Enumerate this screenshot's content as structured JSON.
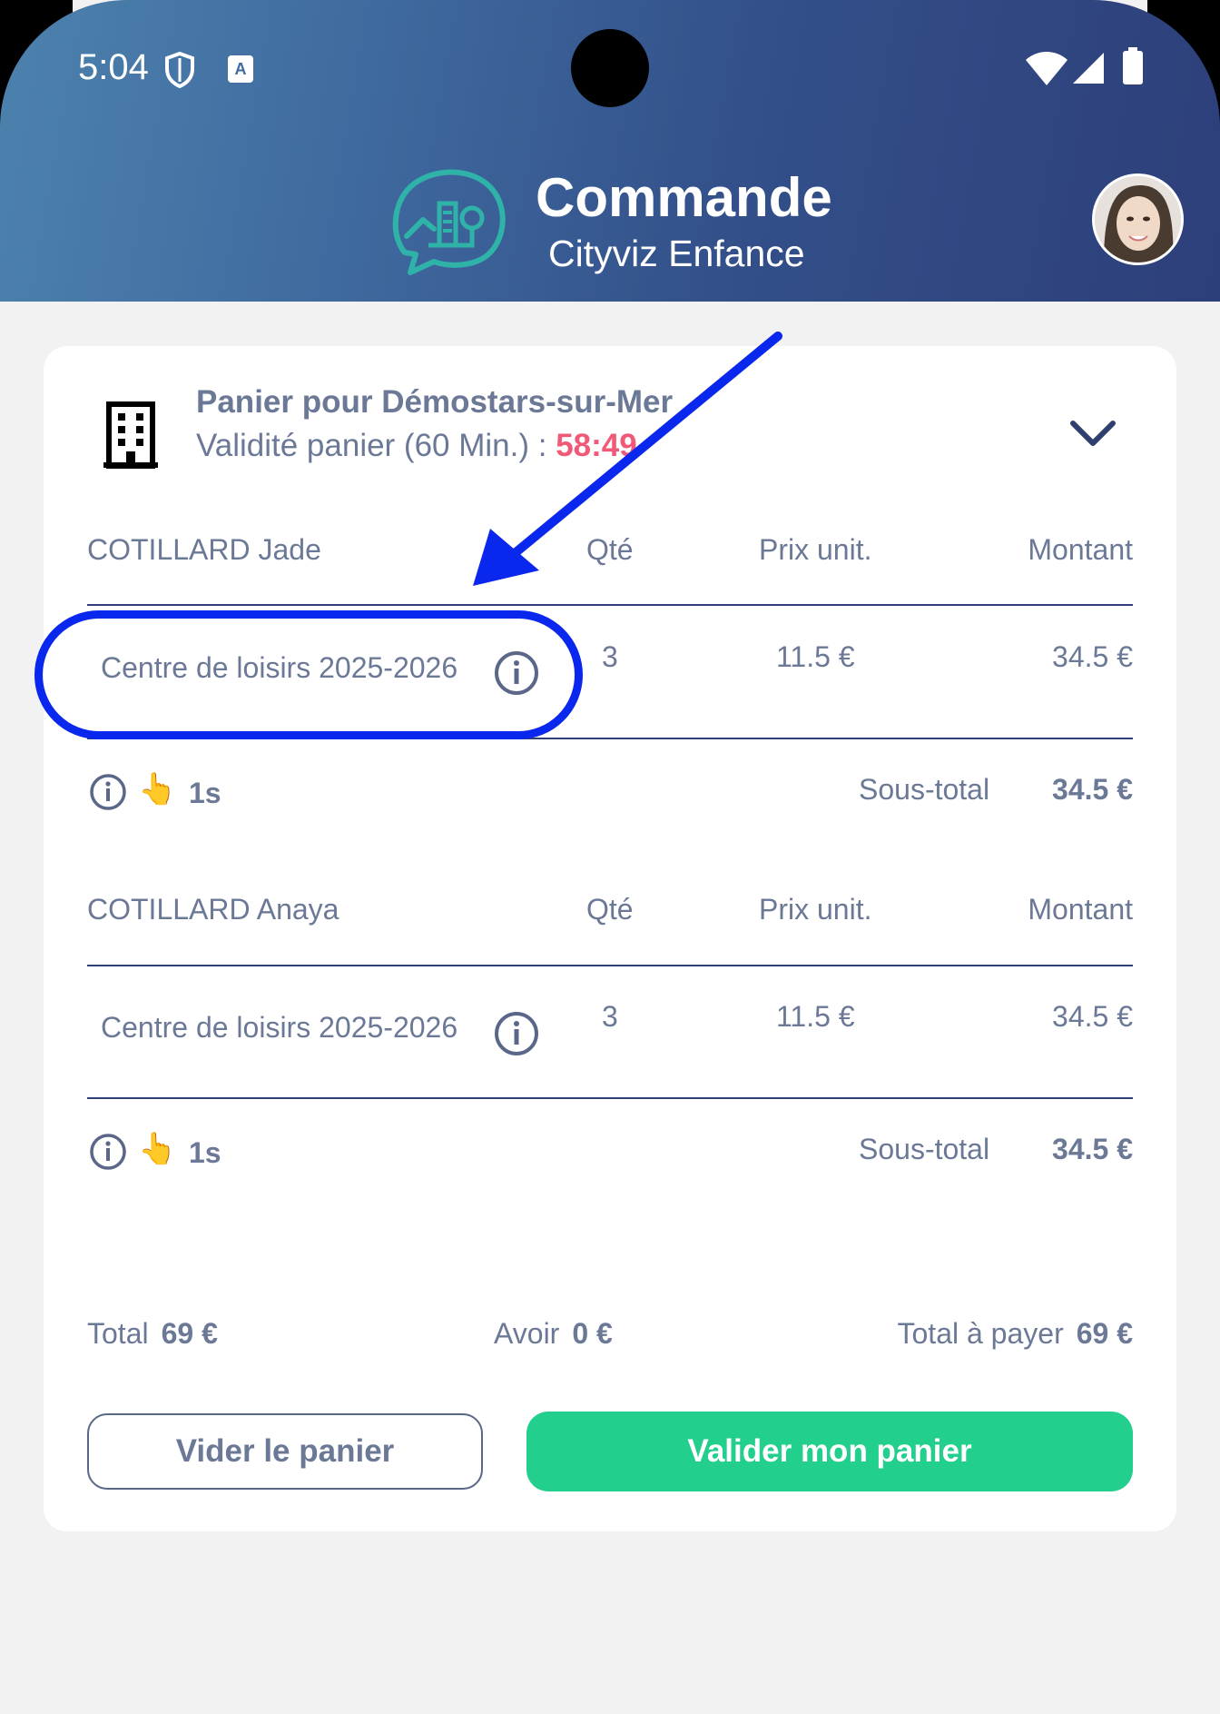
{
  "status_bar": {
    "time": "5:04"
  },
  "header": {
    "title": "Commande",
    "subtitle": "Cityviz Enfance"
  },
  "cart": {
    "title": "Panier pour Démostars-sur-Mer",
    "validity_label": "Validité panier (60 Min.) :",
    "timer": "58:49"
  },
  "columns": {
    "qty": "Qté",
    "unit_price": "Prix unit.",
    "amount": "Montant"
  },
  "children": [
    {
      "name": "COTILLARD Jade",
      "item": "Centre de loisirs 2025-2026",
      "qty": "3",
      "unit_price": "11.5 €",
      "amount": "34.5 €",
      "duration": "1s",
      "subtotal_label": "Sous-total",
      "subtotal": "34.5 €"
    },
    {
      "name": "COTILLARD Anaya",
      "item": "Centre de loisirs 2025-2026",
      "qty": "3",
      "unit_price": "11.5 €",
      "amount": "34.5 €",
      "duration": "1s",
      "subtotal_label": "Sous-total",
      "subtotal": "34.5 €"
    }
  ],
  "totals": {
    "total_label": "Total",
    "total": "69 €",
    "credit_label": "Avoir",
    "credit": "0 €",
    "to_pay_label": "Total à payer",
    "to_pay": "69 €"
  },
  "buttons": {
    "clear": "Vider le panier",
    "validate": "Valider mon panier"
  },
  "icons": {
    "status": [
      "shield-icon",
      "app-notification-icon",
      "wifi-icon",
      "signal-icon",
      "battery-icon"
    ],
    "logo": "cityviz-logo",
    "building": "building-icon",
    "chevron": "chevron-down-icon",
    "info": "info-icon",
    "pointer": "👆"
  },
  "colors": {
    "accent_green": "#22cf8c",
    "timer_red": "#f05a78",
    "header_dark": "#2d3f7a",
    "header_light": "#4d82ad",
    "annotation_blue": "#0a27ee"
  }
}
